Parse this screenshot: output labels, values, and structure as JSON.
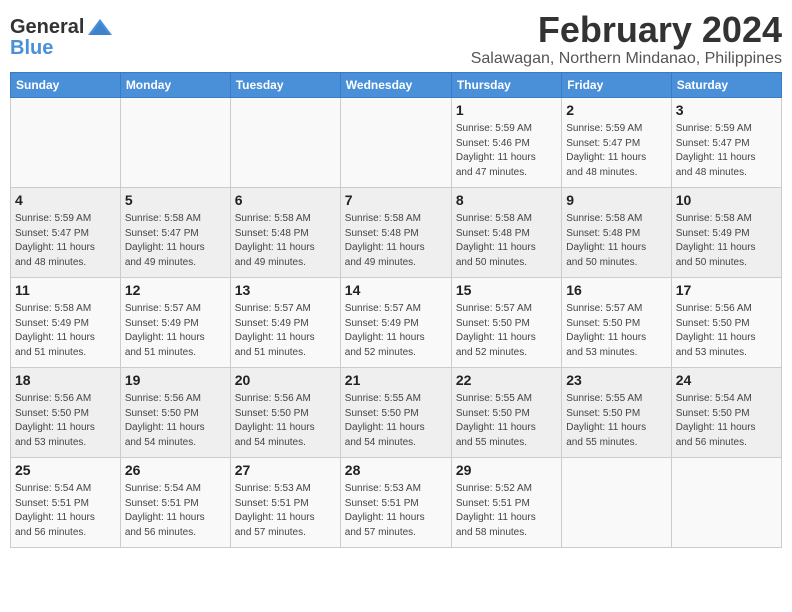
{
  "logo": {
    "general": "General",
    "blue": "Blue"
  },
  "title": "February 2024",
  "subtitle": "Salawagan, Northern Mindanao, Philippines",
  "days_of_week": [
    "Sunday",
    "Monday",
    "Tuesday",
    "Wednesday",
    "Thursday",
    "Friday",
    "Saturday"
  ],
  "weeks": [
    [
      {
        "day": "",
        "info": ""
      },
      {
        "day": "",
        "info": ""
      },
      {
        "day": "",
        "info": ""
      },
      {
        "day": "",
        "info": ""
      },
      {
        "day": "1",
        "info": "Sunrise: 5:59 AM\nSunset: 5:46 PM\nDaylight: 11 hours\nand 47 minutes."
      },
      {
        "day": "2",
        "info": "Sunrise: 5:59 AM\nSunset: 5:47 PM\nDaylight: 11 hours\nand 48 minutes."
      },
      {
        "day": "3",
        "info": "Sunrise: 5:59 AM\nSunset: 5:47 PM\nDaylight: 11 hours\nand 48 minutes."
      }
    ],
    [
      {
        "day": "4",
        "info": "Sunrise: 5:59 AM\nSunset: 5:47 PM\nDaylight: 11 hours\nand 48 minutes."
      },
      {
        "day": "5",
        "info": "Sunrise: 5:58 AM\nSunset: 5:47 PM\nDaylight: 11 hours\nand 49 minutes."
      },
      {
        "day": "6",
        "info": "Sunrise: 5:58 AM\nSunset: 5:48 PM\nDaylight: 11 hours\nand 49 minutes."
      },
      {
        "day": "7",
        "info": "Sunrise: 5:58 AM\nSunset: 5:48 PM\nDaylight: 11 hours\nand 49 minutes."
      },
      {
        "day": "8",
        "info": "Sunrise: 5:58 AM\nSunset: 5:48 PM\nDaylight: 11 hours\nand 50 minutes."
      },
      {
        "day": "9",
        "info": "Sunrise: 5:58 AM\nSunset: 5:48 PM\nDaylight: 11 hours\nand 50 minutes."
      },
      {
        "day": "10",
        "info": "Sunrise: 5:58 AM\nSunset: 5:49 PM\nDaylight: 11 hours\nand 50 minutes."
      }
    ],
    [
      {
        "day": "11",
        "info": "Sunrise: 5:58 AM\nSunset: 5:49 PM\nDaylight: 11 hours\nand 51 minutes."
      },
      {
        "day": "12",
        "info": "Sunrise: 5:57 AM\nSunset: 5:49 PM\nDaylight: 11 hours\nand 51 minutes."
      },
      {
        "day": "13",
        "info": "Sunrise: 5:57 AM\nSunset: 5:49 PM\nDaylight: 11 hours\nand 51 minutes."
      },
      {
        "day": "14",
        "info": "Sunrise: 5:57 AM\nSunset: 5:49 PM\nDaylight: 11 hours\nand 52 minutes."
      },
      {
        "day": "15",
        "info": "Sunrise: 5:57 AM\nSunset: 5:50 PM\nDaylight: 11 hours\nand 52 minutes."
      },
      {
        "day": "16",
        "info": "Sunrise: 5:57 AM\nSunset: 5:50 PM\nDaylight: 11 hours\nand 53 minutes."
      },
      {
        "day": "17",
        "info": "Sunrise: 5:56 AM\nSunset: 5:50 PM\nDaylight: 11 hours\nand 53 minutes."
      }
    ],
    [
      {
        "day": "18",
        "info": "Sunrise: 5:56 AM\nSunset: 5:50 PM\nDaylight: 11 hours\nand 53 minutes."
      },
      {
        "day": "19",
        "info": "Sunrise: 5:56 AM\nSunset: 5:50 PM\nDaylight: 11 hours\nand 54 minutes."
      },
      {
        "day": "20",
        "info": "Sunrise: 5:56 AM\nSunset: 5:50 PM\nDaylight: 11 hours\nand 54 minutes."
      },
      {
        "day": "21",
        "info": "Sunrise: 5:55 AM\nSunset: 5:50 PM\nDaylight: 11 hours\nand 54 minutes."
      },
      {
        "day": "22",
        "info": "Sunrise: 5:55 AM\nSunset: 5:50 PM\nDaylight: 11 hours\nand 55 minutes."
      },
      {
        "day": "23",
        "info": "Sunrise: 5:55 AM\nSunset: 5:50 PM\nDaylight: 11 hours\nand 55 minutes."
      },
      {
        "day": "24",
        "info": "Sunrise: 5:54 AM\nSunset: 5:50 PM\nDaylight: 11 hours\nand 56 minutes."
      }
    ],
    [
      {
        "day": "25",
        "info": "Sunrise: 5:54 AM\nSunset: 5:51 PM\nDaylight: 11 hours\nand 56 minutes."
      },
      {
        "day": "26",
        "info": "Sunrise: 5:54 AM\nSunset: 5:51 PM\nDaylight: 11 hours\nand 56 minutes."
      },
      {
        "day": "27",
        "info": "Sunrise: 5:53 AM\nSunset: 5:51 PM\nDaylight: 11 hours\nand 57 minutes."
      },
      {
        "day": "28",
        "info": "Sunrise: 5:53 AM\nSunset: 5:51 PM\nDaylight: 11 hours\nand 57 minutes."
      },
      {
        "day": "29",
        "info": "Sunrise: 5:52 AM\nSunset: 5:51 PM\nDaylight: 11 hours\nand 58 minutes."
      },
      {
        "day": "",
        "info": ""
      },
      {
        "day": "",
        "info": ""
      }
    ]
  ]
}
